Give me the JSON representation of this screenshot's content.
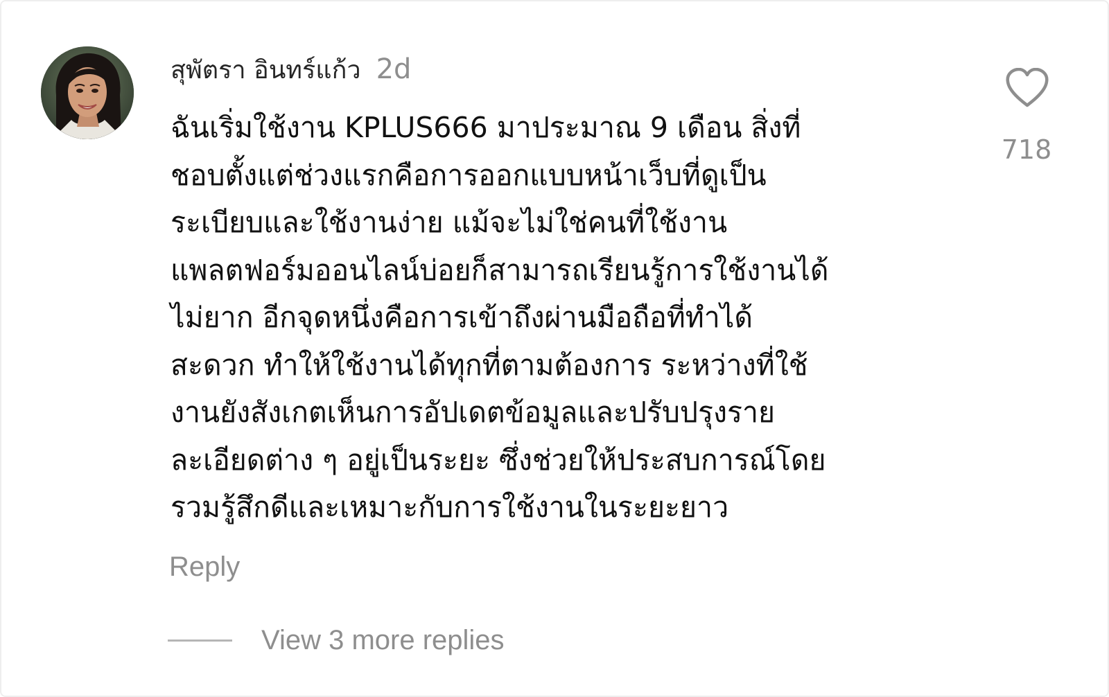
{
  "comment": {
    "avatar_icon": "user-avatar",
    "username": "สุพัตรา อินทร์แก้ว",
    "timestamp": "2d",
    "body_lines": [
      "ฉันเริ่มใช้งาน KPLUS666 มาประมาณ 9 เดือน สิ่งที่",
      "ชอบตั้งแต่ช่วงแรกคือการออกแบบหน้าเว็บที่ดูเป็น",
      "ระเบียบและใช้งานง่าย แม้จะไม่ใช่คนที่ใช้งาน",
      "แพลตฟอร์มออนไลน์บ่อยก็สามารถเรียนรู้การใช้งานได้",
      "ไม่ยาก อีกจุดหนึ่งคือการเข้าถึงผ่านมือถือที่ทำได้",
      "สะดวก ทำให้ใช้งานได้ทุกที่ตามต้องการ ระหว่างที่ใช้",
      "งานยังสังเกตเห็นการอัปเดตข้อมูลและปรับปรุงราย",
      "ละเอียดต่าง ๆ อยู่เป็นระยะ ซึ่งช่วยให้ประสบการณ์โดย",
      "รวมรู้สึกดีและเหมาะกับการใช้งานในระยะยาว"
    ],
    "like_icon": "heart-outline-icon",
    "like_count": "718",
    "reply_label": "Reply",
    "view_replies_label": "View 3 more replies"
  },
  "colors": {
    "text_primary": "#111111",
    "text_secondary": "#8e8e8e",
    "divider": "#b5b5b5",
    "background": "#ffffff"
  }
}
